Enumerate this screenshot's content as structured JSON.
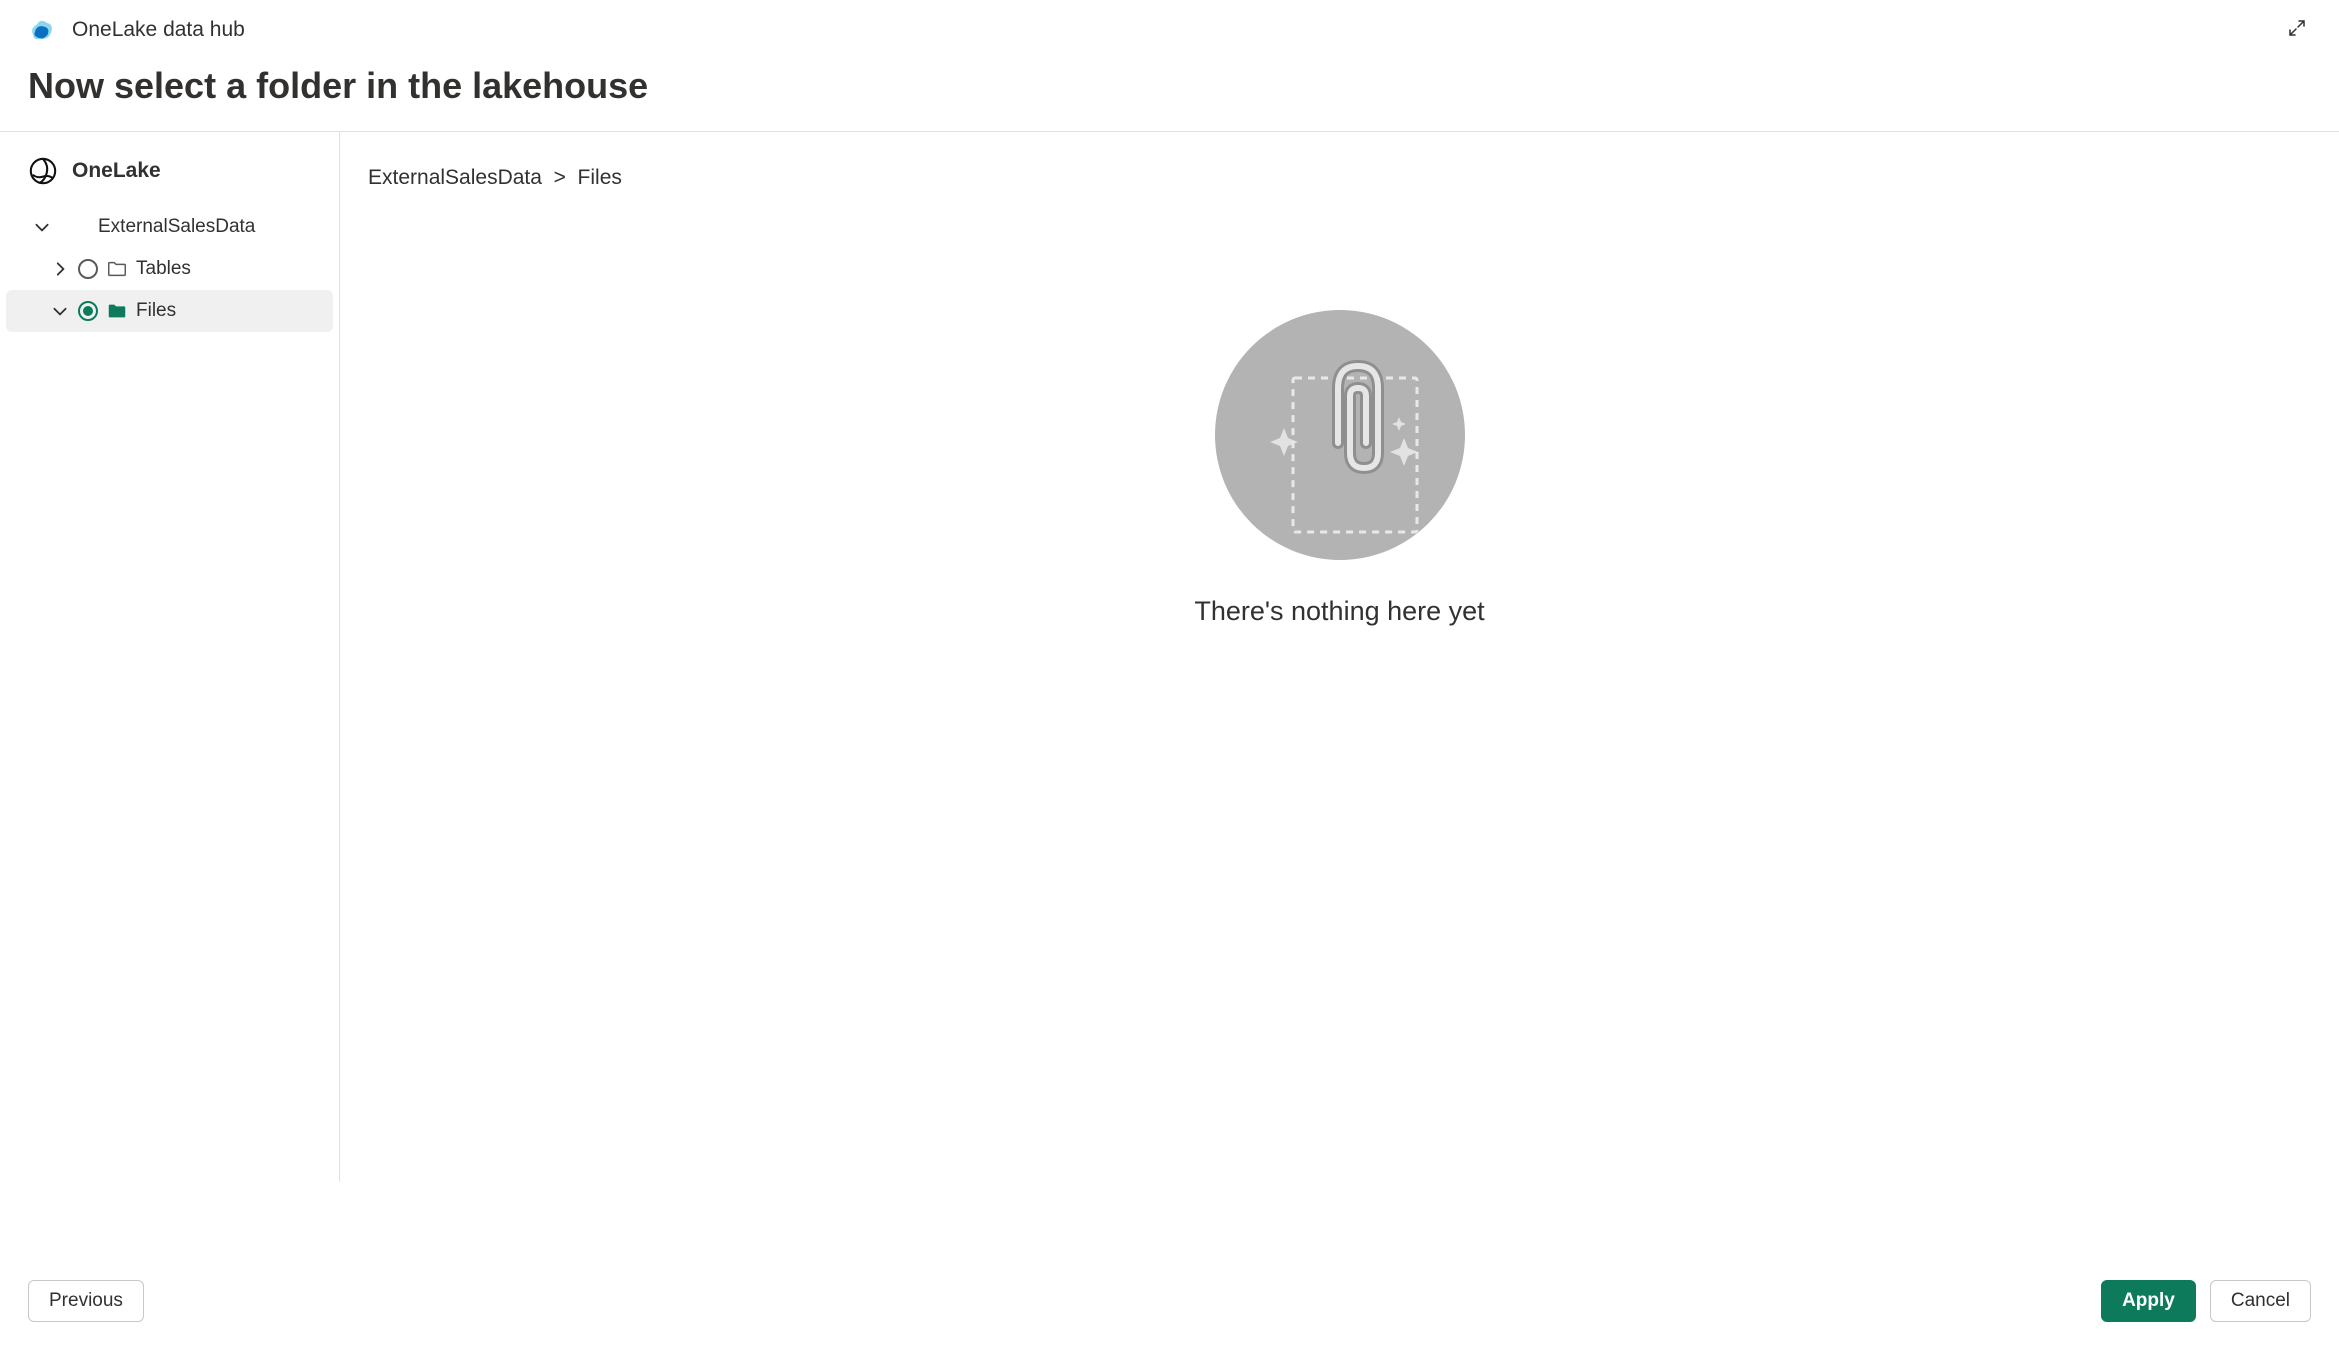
{
  "header": {
    "title": "OneLake data hub"
  },
  "page_title": "Now select a folder in the lakehouse",
  "sidebar": {
    "root_label": "OneLake",
    "level1_label": "ExternalSalesData",
    "items": [
      {
        "label": "Tables",
        "selected": false
      },
      {
        "label": "Files",
        "selected": true
      }
    ]
  },
  "breadcrumb": {
    "part1": "ExternalSalesData",
    "sep": ">",
    "part2": "Files"
  },
  "empty_state_text": "There's nothing here yet",
  "buttons": {
    "previous": "Previous",
    "apply": "Apply",
    "cancel": "Cancel"
  }
}
